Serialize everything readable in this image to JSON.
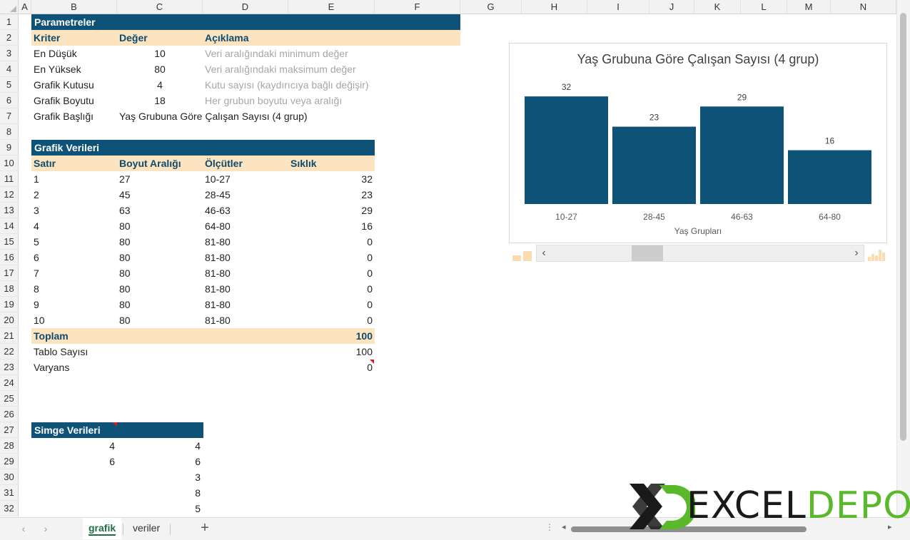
{
  "columns": [
    "A",
    "B",
    "C",
    "D",
    "E",
    "F",
    "G",
    "H",
    "I",
    "J",
    "K",
    "L",
    "M",
    "N"
  ],
  "rows": [
    "1",
    "2",
    "3",
    "4",
    "5",
    "6",
    "7",
    "8",
    "9",
    "10",
    "11",
    "12",
    "13",
    "14",
    "15",
    "16",
    "17",
    "18",
    "19",
    "20",
    "21",
    "22",
    "23",
    "24",
    "25",
    "26",
    "27",
    "28",
    "29",
    "30",
    "31",
    "32"
  ],
  "params": {
    "header": "Parametreler",
    "col_kriter": "Kriter",
    "col_deger": "Değer",
    "col_aciklama": "Açıklama",
    "items": [
      {
        "kriter": "En Düşük",
        "deger": "10",
        "aciklama": "Veri aralığındaki minimum değer"
      },
      {
        "kriter": "En Yüksek",
        "deger": "80",
        "aciklama": "Veri aralığındaki maksimum değer"
      },
      {
        "kriter": "Grafik Kutusu",
        "deger": "4",
        "aciklama": "Kutu sayısı (kaydırıcıya bağlı değişir)"
      },
      {
        "kriter": "Grafik Boyutu",
        "deger": "18",
        "aciklama": "Her grubun boyutu veya aralığı"
      }
    ],
    "title_label": "Grafik Başlığı",
    "title_value": "Yaş Grubuna Göre Çalışan Sayısı (4 grup)"
  },
  "grafik": {
    "header": "Grafik Verileri",
    "col_satir": "Satır",
    "col_boyut": "Boyut Aralığı",
    "col_olcut": "Ölçütler",
    "col_siklik": "Sıklık",
    "rows": [
      {
        "satir": "1",
        "boyut": "27",
        "olcut": "10-27",
        "siklik": "32"
      },
      {
        "satir": "2",
        "boyut": "45",
        "olcut": "28-45",
        "siklik": "23"
      },
      {
        "satir": "3",
        "boyut": "63",
        "olcut": "46-63",
        "siklik": "29"
      },
      {
        "satir": "4",
        "boyut": "80",
        "olcut": "64-80",
        "siklik": "16"
      },
      {
        "satir": "5",
        "boyut": "80",
        "olcut": "81-80",
        "siklik": "0"
      },
      {
        "satir": "6",
        "boyut": "80",
        "olcut": "81-80",
        "siklik": "0"
      },
      {
        "satir": "7",
        "boyut": "80",
        "olcut": "81-80",
        "siklik": "0"
      },
      {
        "satir": "8",
        "boyut": "80",
        "olcut": "81-80",
        "siklik": "0"
      },
      {
        "satir": "9",
        "boyut": "80",
        "olcut": "81-80",
        "siklik": "0"
      },
      {
        "satir": "10",
        "boyut": "80",
        "olcut": "81-80",
        "siklik": "0"
      }
    ],
    "toplam_label": "Toplam",
    "toplam_value": "100",
    "tablo_label": "Tablo Sayısı",
    "tablo_value": "100",
    "varyans_label": "Varyans",
    "varyans_value": "0"
  },
  "simge": {
    "header": "Simge Verileri",
    "col_b": [
      "4",
      "6"
    ],
    "col_c": [
      "4",
      "6",
      "3",
      "8",
      "5"
    ]
  },
  "chart_data": {
    "type": "bar",
    "title": "Yaş Grubuna Göre Çalışan Sayısı (4 grup)",
    "xlabel": "Yaş Grupları",
    "ylabel": "",
    "categories": [
      "10-27",
      "28-45",
      "46-63",
      "64-80"
    ],
    "values": [
      32,
      23,
      29,
      16
    ],
    "ylim": [
      0,
      35
    ],
    "grid": false,
    "legend": "none",
    "bar_color": "#0f5278"
  },
  "scroll_control": {
    "value_fraction": 0.3
  },
  "tabs": [
    {
      "label": "grafik",
      "active": true
    },
    {
      "label": "veriler",
      "active": false
    }
  ],
  "add_tab_label": "+",
  "logo": {
    "part1": "EXCEL",
    "part2": "DEPO"
  },
  "colors": {
    "header_dark": "#0f5278",
    "header_light": "#fde4c0",
    "accent_green": "#59b92a"
  }
}
